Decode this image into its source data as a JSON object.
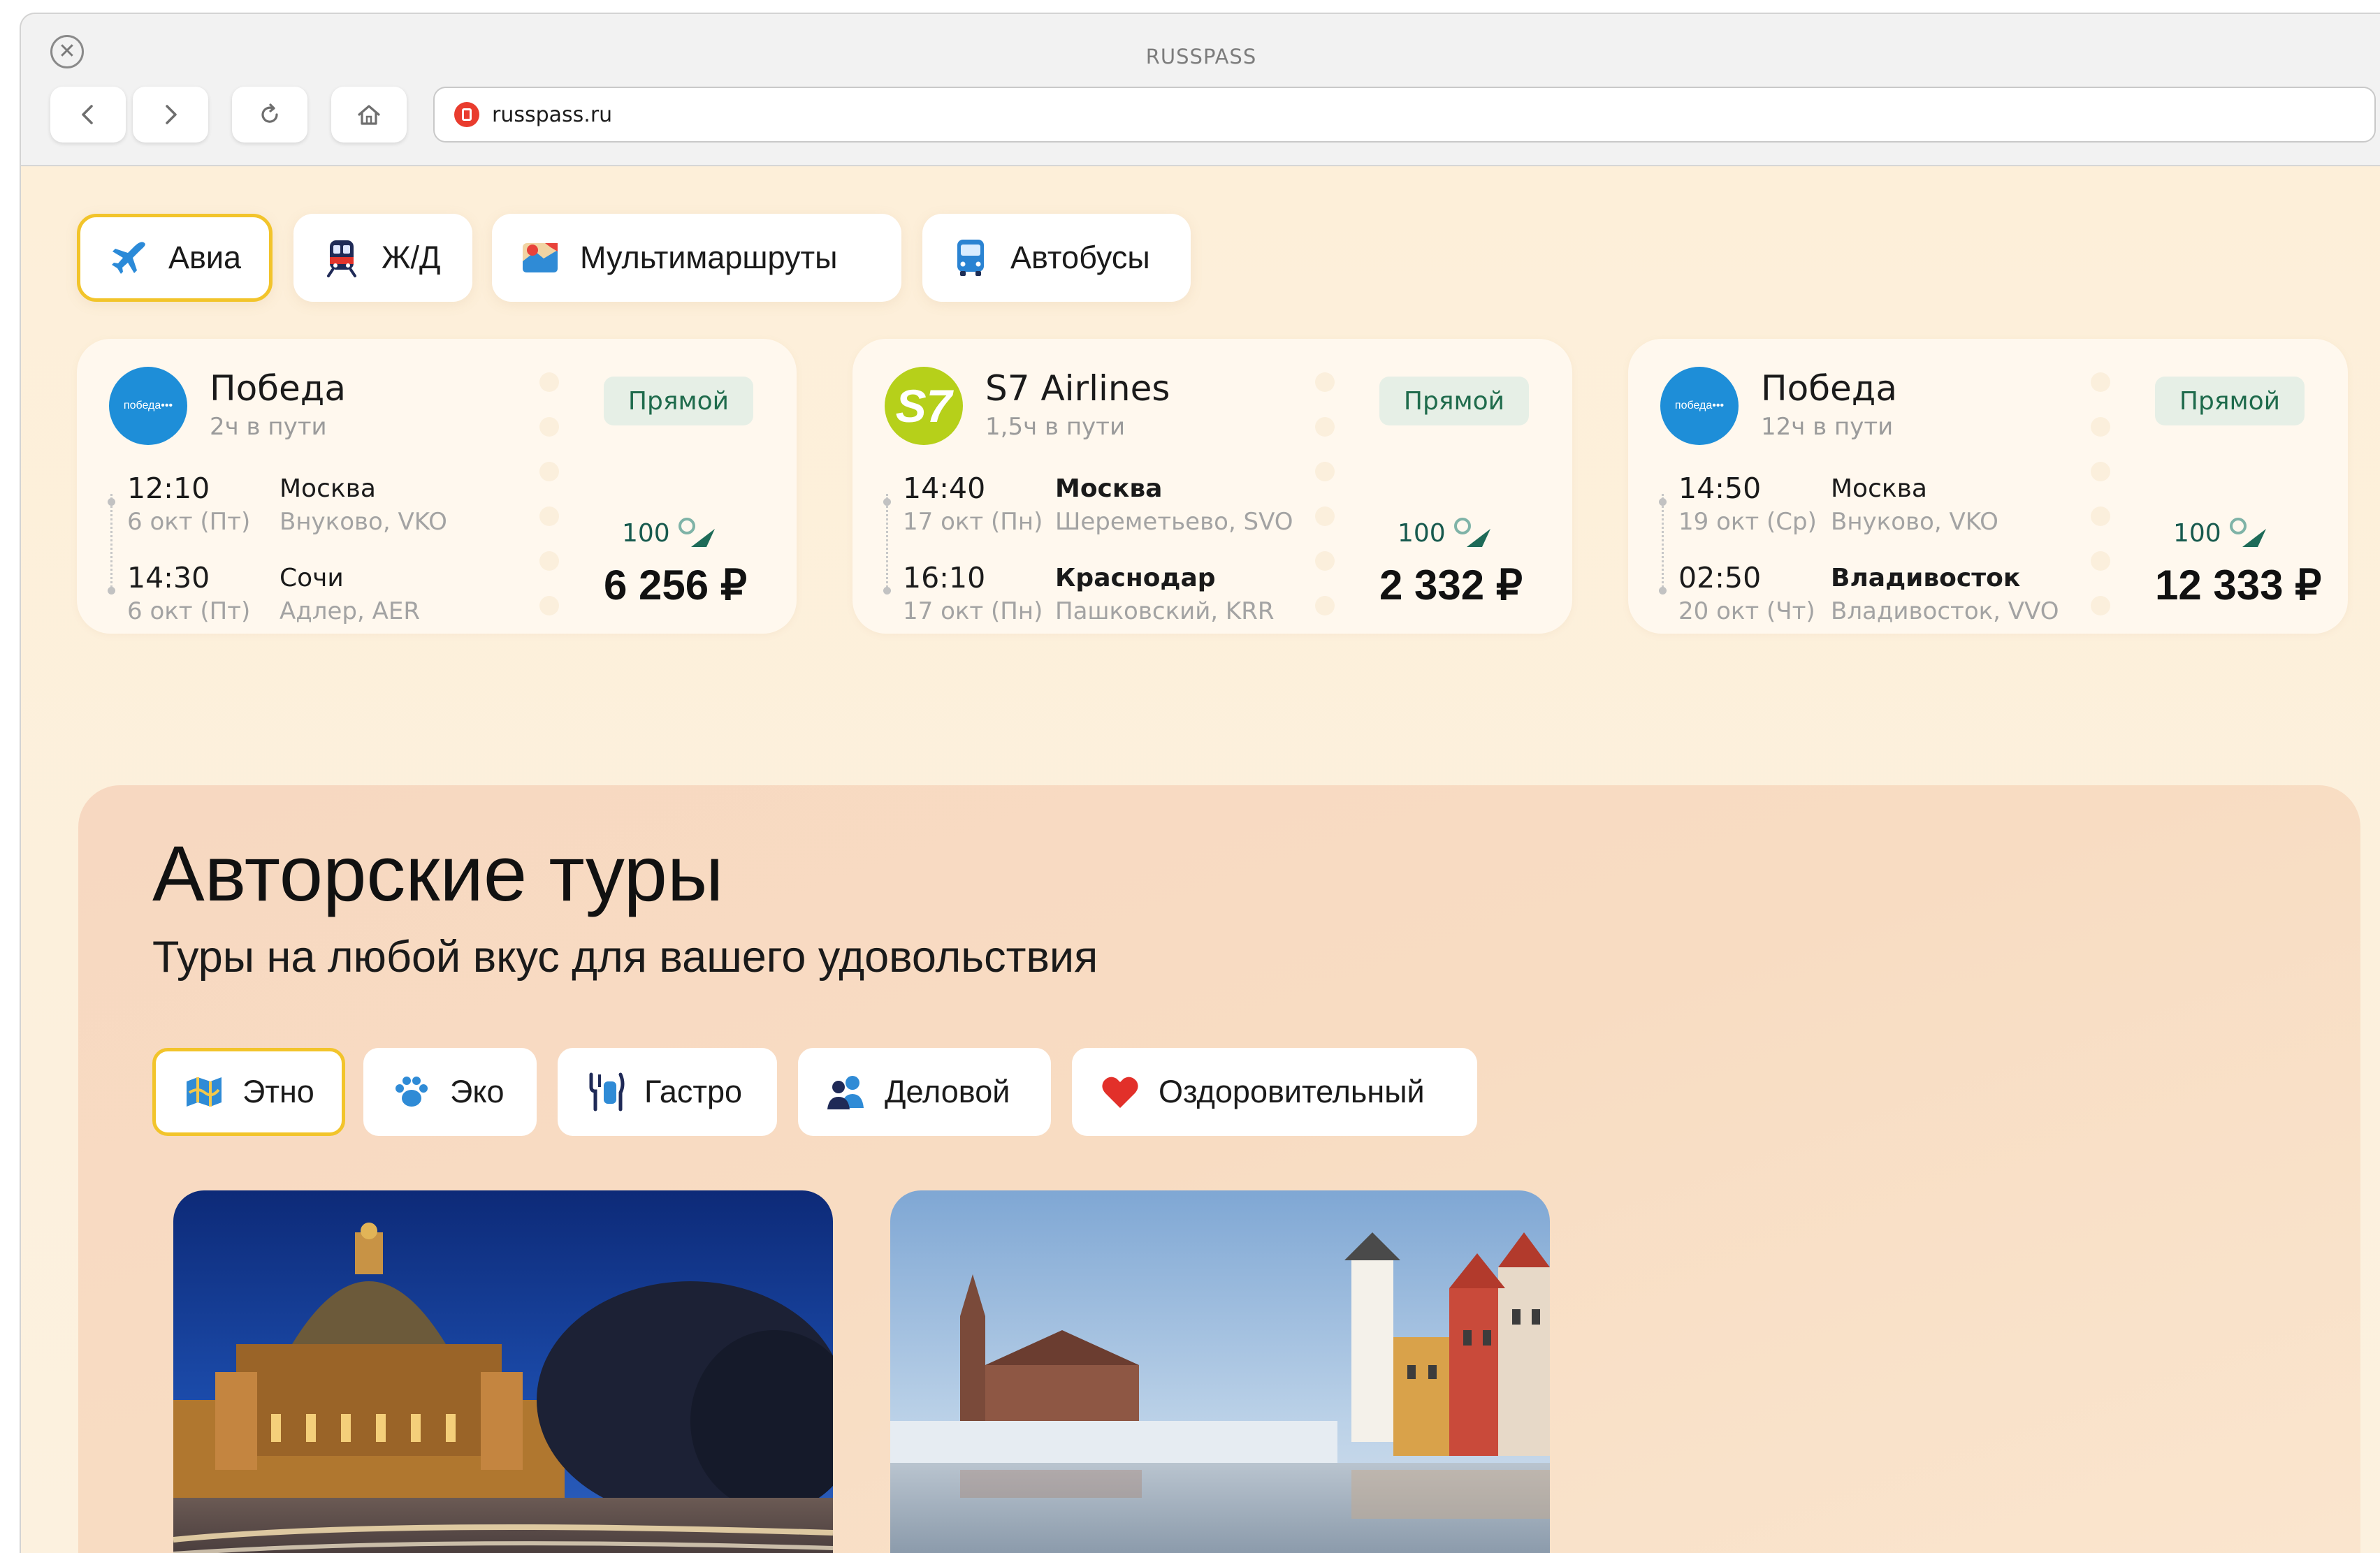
{
  "browser": {
    "window_title": "RUSSPASS",
    "close_glyph": "✕",
    "url": "russpass.ru",
    "buttons": [
      "back-icon",
      "forward-icon",
      "reload-icon",
      "home-icon"
    ]
  },
  "transport_tabs": [
    {
      "label": "Авиа",
      "icon": "plane-icon",
      "active": true
    },
    {
      "label": "Ж/Д",
      "icon": "train-icon",
      "active": false
    },
    {
      "label": "Мультимаршруты",
      "icon": "multiroute-icon",
      "active": false
    },
    {
      "label": "Автобусы",
      "icon": "bus-icon",
      "active": false
    }
  ],
  "flights": [
    {
      "airline": "Победа",
      "logo_text": "победа•••",
      "duration": "2ч в пути",
      "badge": "Прямой",
      "dep_time": "12:10",
      "dep_date": "6 окт (Пт)",
      "dep_city": "Москва",
      "dep_airport": "Внуково, VKO",
      "arr_time": "14:30",
      "arr_date": "6 окт (Пт)",
      "arr_city": "Сочи",
      "arr_airport": "Адлер, AER",
      "miles": "100",
      "price": "6 256 ₽"
    },
    {
      "airline": "S7 Airlines",
      "logo_text": "S7",
      "duration": "1,5ч в пути",
      "badge": "Прямой",
      "dep_time": "14:40",
      "dep_date": "17 окт (Пн)",
      "dep_city": "Москва",
      "dep_airport": "Шереметьево, SVO",
      "arr_time": "16:10",
      "arr_date": "17 окт (Пн)",
      "arr_city": "Краснодар",
      "arr_airport": "Пашковский, KRR",
      "miles": "100",
      "price": "2 332 ₽"
    },
    {
      "airline": "Победа",
      "logo_text": "победа•••",
      "duration": "12ч в пути",
      "badge": "Прямой",
      "dep_time": "14:50",
      "dep_date": "19 окт (Ср)",
      "dep_city": "Москва",
      "dep_airport": "Внуково, VKO",
      "arr_time": "02:50",
      "arr_date": "20 окт (Чт)",
      "arr_city": "Владивосток",
      "arr_airport": "Владивосток, VVO",
      "miles": "100",
      "price": "12 333 ₽"
    }
  ],
  "tours": {
    "title": "Авторские туры",
    "subtitle": "Туры на любой вкус для вашего удовольствия",
    "categories": [
      {
        "label": "Этно",
        "icon": "map-icon",
        "active": true
      },
      {
        "label": "Эко",
        "icon": "paw-icon",
        "active": false
      },
      {
        "label": "Гастро",
        "icon": "cutlery-icon",
        "active": false
      },
      {
        "label": "Деловой",
        "icon": "people-icon",
        "active": false
      },
      {
        "label": "Оздоровительный",
        "icon": "heart-icon",
        "active": false
      }
    ],
    "cards": [
      {
        "image": "saint-petersburg-cathedral-night-photo"
      },
      {
        "image": "kaliningrad-fishing-village-photo"
      }
    ]
  },
  "colors": {
    "page_bg": "#fdefd9",
    "active_border": "#f2c42b",
    "badge_bg": "#e6efe6",
    "badge_text": "#1f6b4c",
    "tours_bg": "#f7d8c1",
    "pobeda_blue": "#1e8ed8",
    "s7_green": "#b6d01a"
  }
}
